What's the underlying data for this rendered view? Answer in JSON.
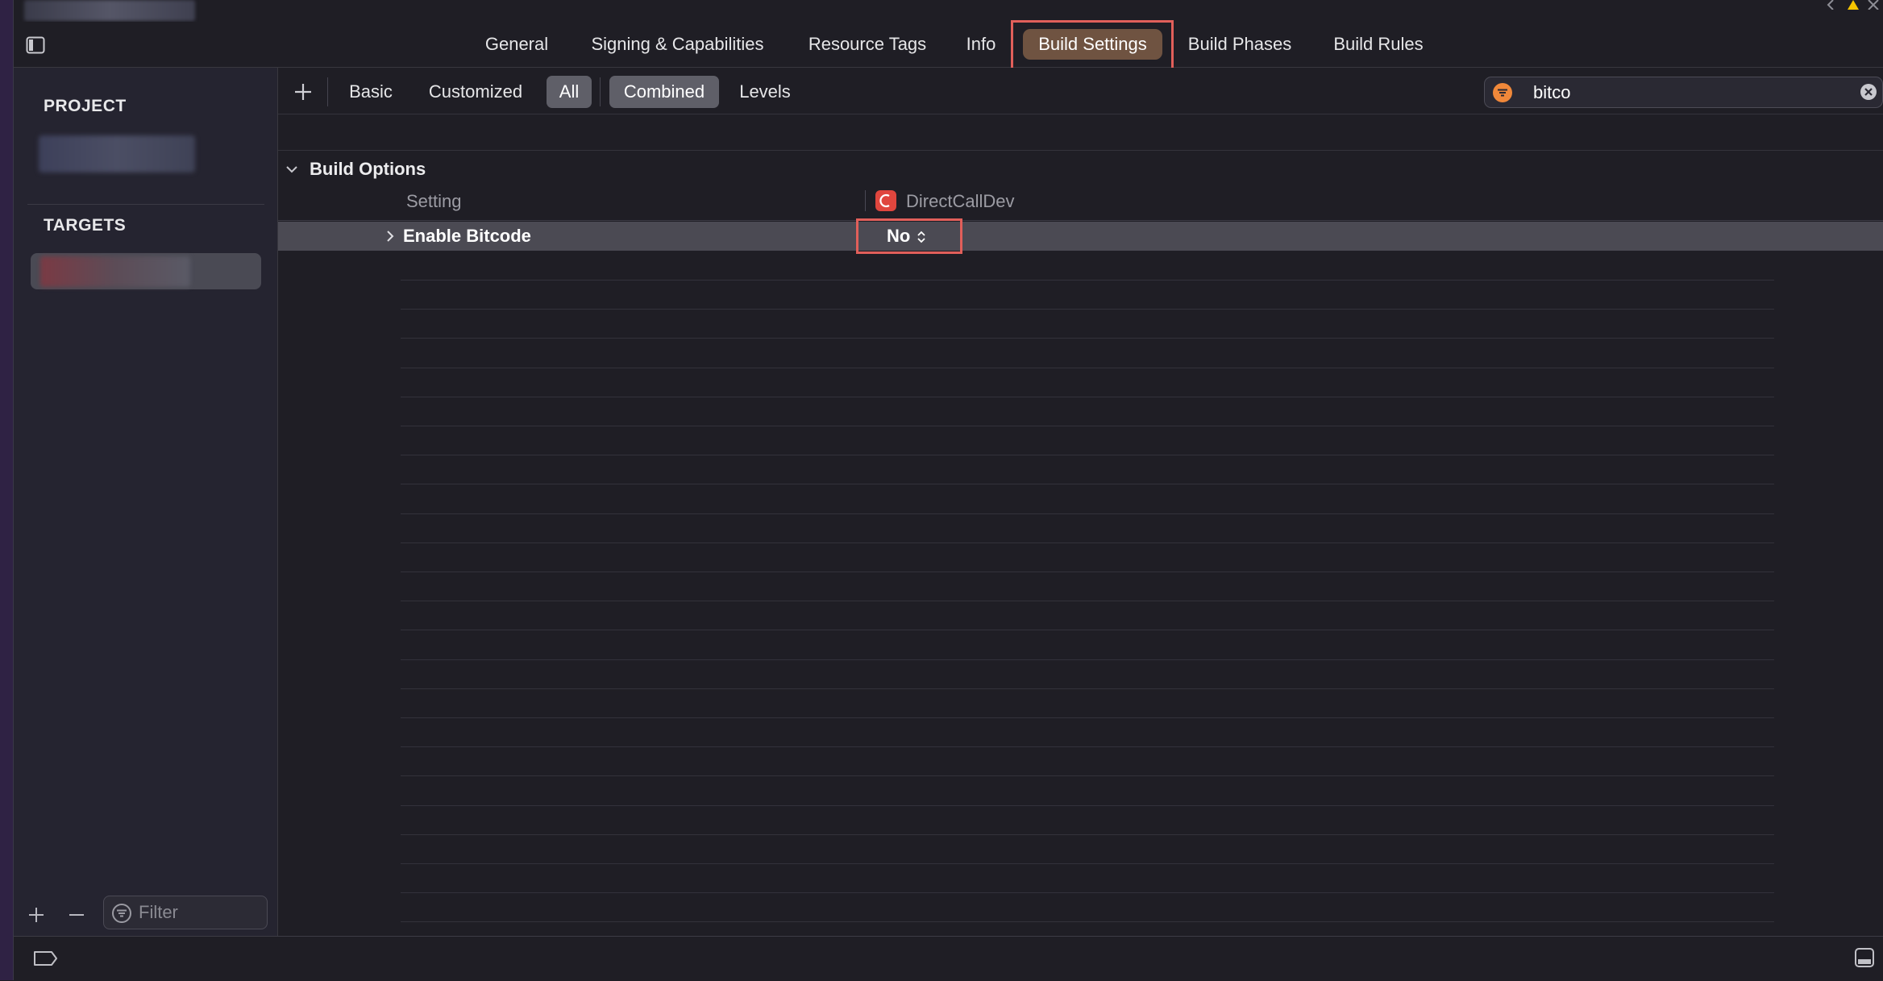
{
  "tabs": [
    {
      "label": "General"
    },
    {
      "label": "Signing & Capabilities"
    },
    {
      "label": "Resource Tags"
    },
    {
      "label": "Info"
    },
    {
      "label": "Build Settings",
      "selected": true
    },
    {
      "label": "Build Phases"
    },
    {
      "label": "Build Rules"
    }
  ],
  "sidebar": {
    "project_heading": "PROJECT",
    "targets_heading": "TARGETS",
    "filter_placeholder": "Filter"
  },
  "toolbar": {
    "segments": [
      {
        "label": "Basic"
      },
      {
        "label": "Customized"
      },
      {
        "label": "All",
        "selected": true
      }
    ],
    "view_modes": [
      {
        "label": "Combined",
        "selected": true
      },
      {
        "label": "Levels"
      }
    ],
    "search_value": "bitco"
  },
  "settings": {
    "group_title": "Build Options",
    "column_setting": "Setting",
    "column_target": "DirectCallDev",
    "rows": [
      {
        "name": "Enable Bitcode",
        "value": "No"
      }
    ]
  },
  "colors": {
    "accent_selected_tab": "#6f5341",
    "highlight_box": "#e15f5a",
    "search_filter_icon": "#f0883a",
    "target_icon": "#e0463e"
  }
}
